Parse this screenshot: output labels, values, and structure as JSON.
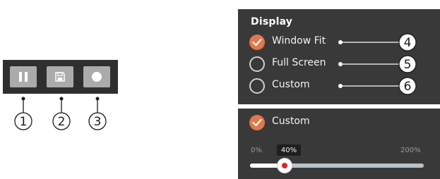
{
  "toolbar": {
    "buttons": [
      {
        "icon": "pause-icon",
        "callout": "1"
      },
      {
        "icon": "save-icon",
        "callout": "2"
      },
      {
        "icon": "record-icon",
        "callout": "3"
      }
    ]
  },
  "display": {
    "title": "Display",
    "options": [
      {
        "label": "Window Fit",
        "selected": true,
        "callout": "4"
      },
      {
        "label": "Full Screen",
        "selected": false,
        "callout": "5"
      },
      {
        "label": "Custom",
        "selected": false,
        "callout": "6"
      }
    ]
  },
  "custom": {
    "label": "Custom",
    "selected": true,
    "min_label": "0%",
    "max_label": "200%",
    "value_label": "40%",
    "value_fraction": 0.2
  },
  "colors": {
    "accent": "#e0784c",
    "panel_bg": "#3a3939",
    "toolbar_bg": "#2f2f2f",
    "button_bg": "#ababab",
    "thumb_dot": "#e02424"
  }
}
